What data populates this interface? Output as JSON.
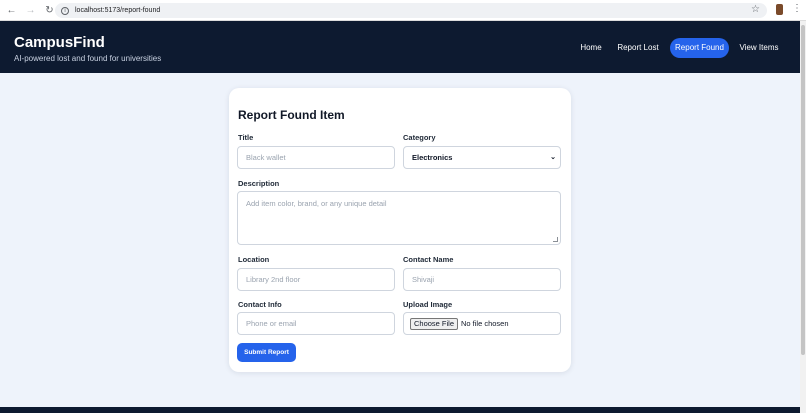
{
  "browser": {
    "url": "localhost:5173/report-found"
  },
  "header": {
    "brand": "CampusFind",
    "tagline": "AI-powered lost and found for universities",
    "nav": {
      "home": "Home",
      "report_lost": "Report Lost",
      "report_found": "Report Found",
      "view_items": "View Items"
    }
  },
  "form": {
    "title": "Report Found Item",
    "title_label": "Title",
    "title_placeholder": "Black wallet",
    "category_label": "Category",
    "category_value": "Electronics",
    "description_label": "Description",
    "description_placeholder": "Add item color, brand, or any unique detail",
    "location_label": "Location",
    "location_placeholder": "Library 2nd floor",
    "contact_name_label": "Contact Name",
    "contact_name_placeholder": "Shivaji",
    "contact_info_label": "Contact Info",
    "contact_info_placeholder": "Phone or email",
    "upload_label": "Upload Image",
    "file_button": "Choose File",
    "file_status": "No file chosen",
    "submit": "Submit Report"
  },
  "colors": {
    "header_bg": "#0d1a30",
    "accent": "#2563eb",
    "page_bg": "#eef3fb"
  }
}
